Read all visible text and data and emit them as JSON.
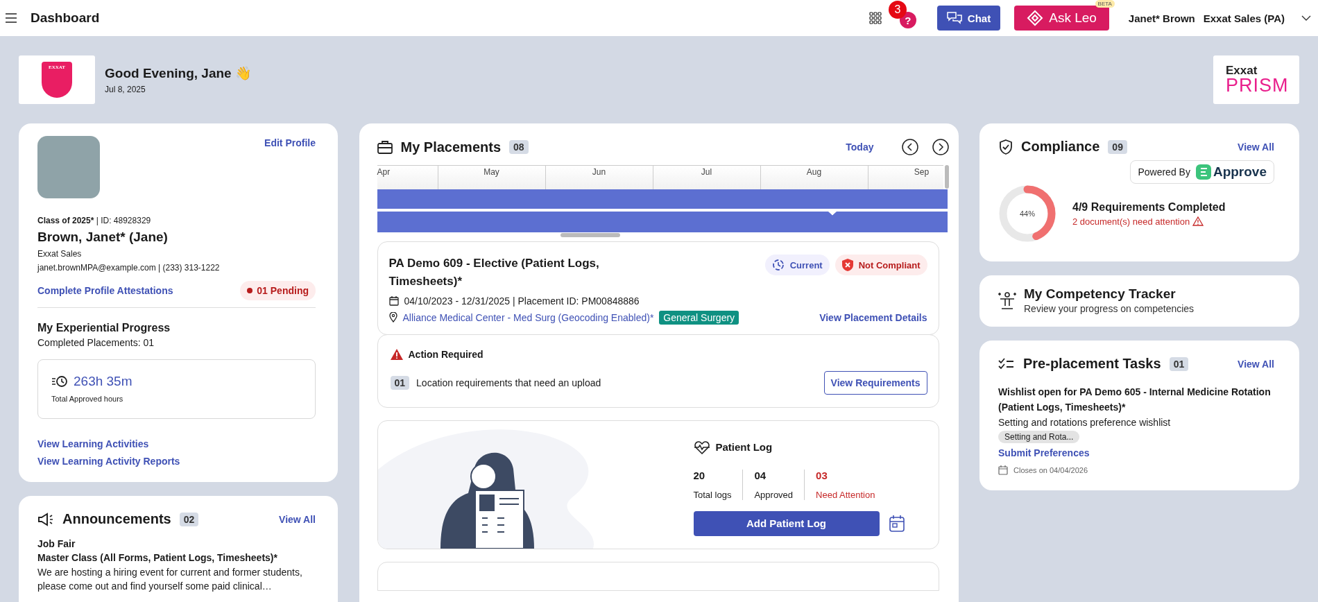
{
  "topbar": {
    "title": "Dashboard",
    "notification_count": "3",
    "help_label": "?",
    "chat_button": "Chat",
    "ask_button": "Ask Leo",
    "ask_badge": "BETA",
    "user_name": "Janet* Brown",
    "organization": "Exxat Sales (PA)"
  },
  "greeting": {
    "logo_text": "EXXAT",
    "title": "Good Evening, Jane 👋",
    "date": "Jul 8, 2025",
    "brand_top": "Exxat",
    "brand_bottom": "PRISM"
  },
  "profile": {
    "edit_link": "Edit Profile",
    "class_label": "Class of 2025*",
    "id_label": "| ID: 48928329",
    "name": "Brown, Janet* (Jane)",
    "organization": "Exxat Sales",
    "email": "janet.brownMPA@example.com",
    "phone": "| (233) 313-1222",
    "attestations_link": "Complete Profile Attestations",
    "pending_badge": "01 Pending",
    "progress_title": "My Experiential Progress",
    "completed_placements": "Completed Placements: 01",
    "hours": "263h 35m",
    "hours_label": "Total Approved hours",
    "links": [
      "View Learning Activities",
      "View Learning Activity Reports"
    ]
  },
  "announcements": {
    "title": "Announcements",
    "count": "02",
    "view_all": "View All",
    "items": [
      {
        "title": "Job Fair",
        "subtitle": "Master Class (All Forms, Patient Logs, Timesheets)*",
        "body": "We are hosting a hiring event for current and former students, please come out and find yourself some paid clinical…"
      }
    ]
  },
  "placements": {
    "title": "My Placements",
    "count": "08",
    "today": "Today",
    "months": [
      "Apr",
      "May",
      "Jun",
      "Jul",
      "Aug",
      "Sep"
    ],
    "placement": {
      "title": "PA Demo 609 - Elective (Patient Logs, Timesheets)*",
      "statuses": [
        {
          "label": "Current",
          "kind": "current"
        },
        {
          "label": "Not Compliant",
          "kind": "noncompliant"
        }
      ],
      "dates": "04/10/2023 - 12/31/2025",
      "placement_id": "| Placement ID: PM00848886",
      "location": "Alliance Medical Center - Med Surg (Geocoding Enabled)*",
      "specialty": "General Surgery",
      "details_link": "View Placement Details"
    },
    "action": {
      "title": "Action Required",
      "items": [
        {
          "count": "01",
          "text": "Location requirements that need an upload"
        }
      ],
      "button": "View Requirements"
    },
    "patient_log": {
      "title": "Patient Log",
      "stats": [
        {
          "value": "20",
          "label": "Total logs",
          "kind": "normal"
        },
        {
          "value": "04",
          "label": "Approved",
          "kind": "normal"
        },
        {
          "value": "03",
          "label": "Need Attention",
          "kind": "alert"
        }
      ],
      "button": "Add Patient Log"
    }
  },
  "compliance": {
    "title": "Compliance",
    "count": "09",
    "view_all": "View All",
    "powered_by": "Powered By",
    "provider": "Approve",
    "level": 0.44,
    "percent": "44%",
    "summary": "4/9 Requirements Completed",
    "attention": "2 document(s) need attention"
  },
  "competency": {
    "title": "My Competency Tracker",
    "subtitle": "Review your progress on competencies"
  },
  "preplacement": {
    "title": "Pre-placement Tasks",
    "count": "01",
    "view_all": "View All",
    "task": {
      "title": "Wishlist open for PA Demo 605 - Internal Medicine Rotation (Patient Logs, Timesheets)*",
      "description": "Setting and rotations preference wishlist",
      "tag": "Setting and Rota...",
      "link": "Submit Preferences",
      "closes": "Closes on 04/04/2026"
    }
  }
}
